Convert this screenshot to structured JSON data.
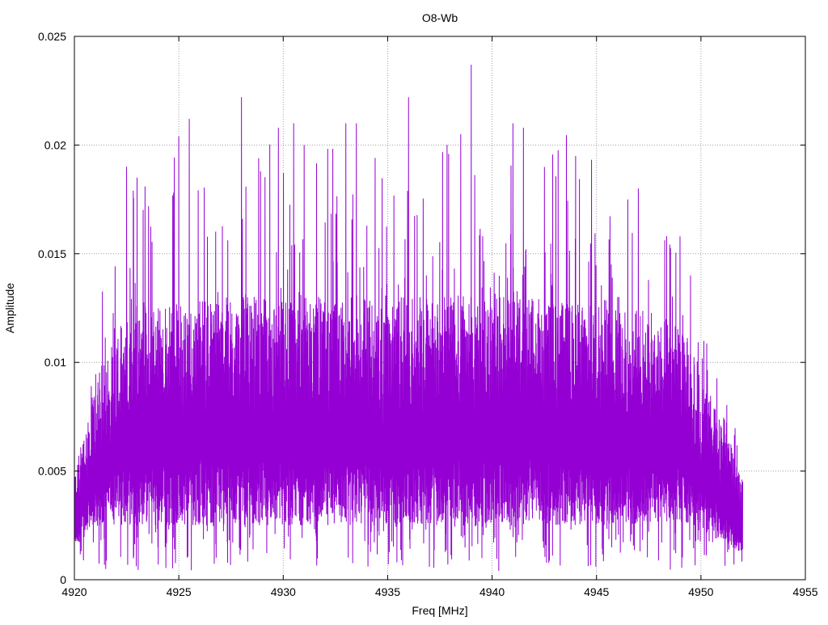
{
  "chart_data": {
    "type": "line",
    "title": "O8-Wb",
    "xlabel": "Freq [MHz]",
    "ylabel": "Amplitude",
    "xlim": [
      4920,
      4955
    ],
    "ylim": [
      0,
      0.025
    ],
    "xticks": [
      "4920",
      "4925",
      "4930",
      "4935",
      "4940",
      "4945",
      "4950",
      "4955"
    ],
    "yticks": [
      "0",
      "0.005",
      "0.01",
      "0.015",
      "0.02",
      "0.025"
    ],
    "grid": true,
    "legend": "none",
    "series_color": "#9400d3",
    "series": [
      {
        "name": "O8-Wb",
        "description_of_envelope": "dense noisy spectrum; values summarized per 0.5 MHz bin",
        "x_start": 4920,
        "x_step": 0.5,
        "peak": [
          0.006,
          0.0107,
          0.011,
          0.0157,
          0.0158,
          0.019,
          0.0185,
          0.0195,
          0.02,
          0.0195,
          0.0204,
          0.0212,
          0.0205,
          0.021,
          0.0224,
          0.021,
          0.0222,
          0.021,
          0.0225,
          0.0215,
          0.0225,
          0.021,
          0.02,
          0.021,
          0.0202,
          0.0215,
          0.021,
          0.021,
          0.021,
          0.0212,
          0.0231,
          0.021,
          0.0222,
          0.0242,
          0.021,
          0.021,
          0.022,
          0.0205,
          0.0237,
          0.021,
          0.0218,
          0.021,
          0.021,
          0.0208,
          0.02,
          0.02,
          0.0203,
          0.021,
          0.0195,
          0.0195,
          0.0198,
          0.018,
          0.0185,
          0.0175,
          0.018,
          0.0165,
          0.016,
          0.016,
          0.0158,
          0.014,
          0.0115,
          0.011,
          0.0095,
          0.008,
          0.0045
        ],
        "upper": [
          0.005,
          0.007,
          0.009,
          0.0105,
          0.0115,
          0.012,
          0.0125,
          0.0125,
          0.0127,
          0.0127,
          0.0128,
          0.0128,
          0.013,
          0.013,
          0.013,
          0.013,
          0.013,
          0.013,
          0.013,
          0.013,
          0.013,
          0.013,
          0.013,
          0.013,
          0.013,
          0.013,
          0.013,
          0.013,
          0.013,
          0.013,
          0.013,
          0.013,
          0.013,
          0.013,
          0.013,
          0.013,
          0.013,
          0.013,
          0.013,
          0.013,
          0.013,
          0.013,
          0.013,
          0.013,
          0.013,
          0.013,
          0.0128,
          0.0128,
          0.0127,
          0.0127,
          0.0126,
          0.0126,
          0.0125,
          0.0125,
          0.0124,
          0.0123,
          0.0122,
          0.012,
          0.0115,
          0.011,
          0.0095,
          0.0085,
          0.007,
          0.006,
          0.0045
        ],
        "lower": [
          0.0015,
          0.002,
          0.0025,
          0.0025,
          0.0025,
          0.0025,
          0.0025,
          0.0025,
          0.0025,
          0.0025,
          0.0025,
          0.0025,
          0.0025,
          0.0025,
          0.0025,
          0.0025,
          0.0025,
          0.0025,
          0.0025,
          0.0025,
          0.0025,
          0.0025,
          0.0025,
          0.0025,
          0.0025,
          0.0025,
          0.0025,
          0.0025,
          0.0025,
          0.0025,
          0.0025,
          0.0025,
          0.0025,
          0.0025,
          0.0025,
          0.0025,
          0.0025,
          0.0025,
          0.0025,
          0.0025,
          0.0025,
          0.0025,
          0.0025,
          0.0025,
          0.0025,
          0.0025,
          0.0025,
          0.0025,
          0.0025,
          0.0025,
          0.0025,
          0.0025,
          0.0025,
          0.0025,
          0.0025,
          0.0025,
          0.0025,
          0.0025,
          0.0025,
          0.0025,
          0.0022,
          0.002,
          0.0018,
          0.0015,
          0.0012
        ],
        "trough": 0.0004
      }
    ]
  }
}
